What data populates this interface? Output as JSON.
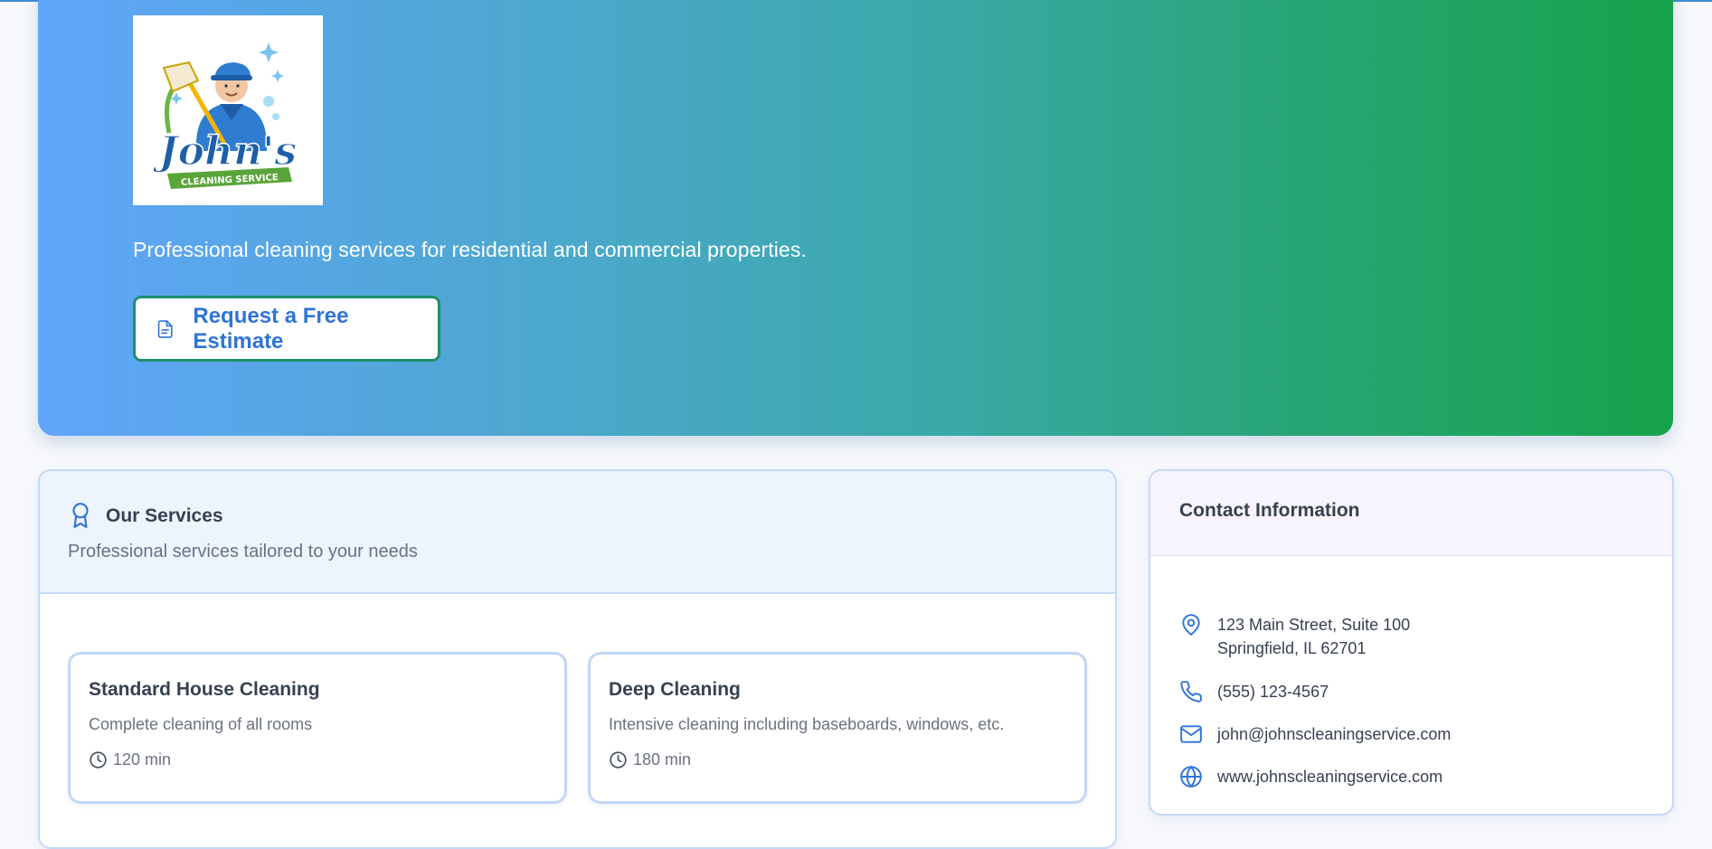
{
  "hero": {
    "logo": {
      "name_text": "John's",
      "banner_text": "CLEANING SERVICE"
    },
    "tagline": "Professional cleaning services for residential and commercial properties.",
    "estimate_button": {
      "label": "Request a Free Estimate",
      "icon": "document-icon"
    }
  },
  "services": {
    "icon": "award-icon",
    "title": "Our Services",
    "subtitle": "Professional services tailored to your needs",
    "items": [
      {
        "name": "Standard House Cleaning",
        "description": "Complete cleaning of all rooms",
        "duration": "120 min"
      },
      {
        "name": "Deep Cleaning",
        "description": "Intensive cleaning including baseboards, windows, etc.",
        "duration": "180 min"
      }
    ]
  },
  "contact": {
    "title": "Contact Information",
    "address_line1": "123 Main Street, Suite 100",
    "address_line2": "Springfield, IL 62701",
    "phone": "(555) 123-4567",
    "email": "john@johnscleaningservice.com",
    "website": "www.johnscleaningservice.com"
  },
  "colors": {
    "accent": "#2f73d9",
    "gradient_start": "#60a5fa",
    "gradient_end": "#16a34a",
    "button_border": "#1d8f6a"
  }
}
